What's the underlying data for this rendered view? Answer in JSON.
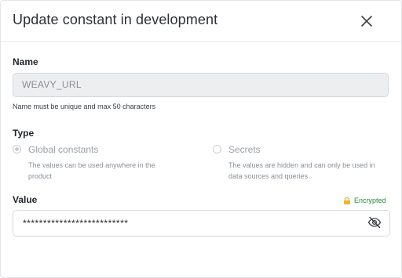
{
  "dialog": {
    "title": "Update constant in development"
  },
  "name_field": {
    "label": "Name",
    "value": "WEAVY_URL",
    "help_text": "Name must be unique and max 50 characters"
  },
  "type_field": {
    "label": "Type",
    "options": [
      {
        "label": "Global constants",
        "description_line1": "The values can be used anywhere in the",
        "description_line2": "product",
        "selected": true
      },
      {
        "label": "Secrets",
        "description_line1": "The values are hidden and can only be used in",
        "description_line2": "data sources and queries",
        "selected": false
      }
    ]
  },
  "value_field": {
    "label": "Value",
    "badge": "Encrypted",
    "masked_value": "**************************"
  },
  "colors": {
    "encrypted": "#2a8a3e",
    "lock": "#f0b429"
  },
  "icons": {
    "close": "close-icon",
    "lock": "lock-icon",
    "visibility": "eye-off-icon"
  }
}
